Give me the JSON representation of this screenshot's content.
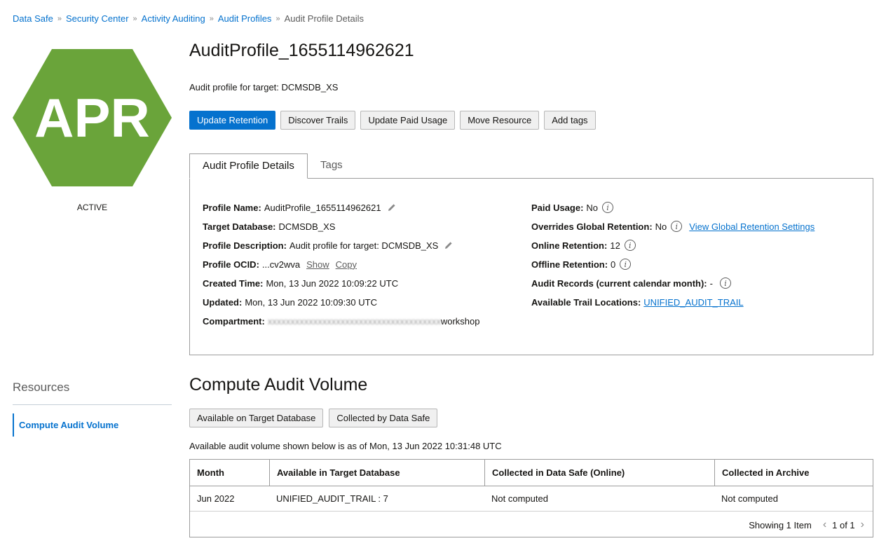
{
  "breadcrumb": {
    "items": [
      "Data Safe",
      "Security Center",
      "Activity Auditing",
      "Audit Profiles"
    ],
    "current": "Audit Profile Details",
    "separator": "»"
  },
  "badge": {
    "initials": "APR",
    "color": "#6aa43a",
    "status": "ACTIVE"
  },
  "header": {
    "title": "AuditProfile_1655114962621",
    "subtitle": "Audit profile for target: DCMSDB_XS"
  },
  "actions": [
    "Update Retention",
    "Discover Trails",
    "Update Paid Usage",
    "Move Resource",
    "Add tags"
  ],
  "tabs": {
    "active": "Audit Profile Details",
    "inactive": "Tags"
  },
  "details": {
    "left": {
      "profile_name": {
        "label": "Profile Name:",
        "value": "AuditProfile_1655114962621"
      },
      "target_database": {
        "label": "Target Database:",
        "value": "DCMSDB_XS"
      },
      "profile_description": {
        "label": "Profile Description:",
        "value": "Audit profile for target: DCMSDB_XS"
      },
      "profile_ocid": {
        "label": "Profile OCID:",
        "value": "...cv2wva",
        "show": "Show",
        "copy": "Copy"
      },
      "created_time": {
        "label": "Created Time:",
        "value": "Mon, 13 Jun 2022 10:09:22 UTC"
      },
      "updated": {
        "label": "Updated:",
        "value": "Mon, 13 Jun 2022 10:09:30 UTC"
      },
      "compartment": {
        "label": "Compartment:",
        "value_redacted": "xxxxxxxxxxxxxxxxxxxxxxxxxxxxxxxxxxxxxx",
        "value_tail": "workshop"
      }
    },
    "right": {
      "paid_usage": {
        "label": "Paid Usage:",
        "value": "No"
      },
      "overrides_global_retention": {
        "label": "Overrides Global Retention:",
        "value": "No",
        "link": "View Global Retention Settings"
      },
      "online_retention": {
        "label": "Online Retention:",
        "value": "12"
      },
      "offline_retention": {
        "label": "Offline Retention:",
        "value": "0"
      },
      "audit_records": {
        "label": "Audit Records (current calendar month):",
        "value": "-"
      },
      "trail_locations": {
        "label": "Available Trail Locations:",
        "value": "UNIFIED_AUDIT_TRAIL"
      }
    }
  },
  "resources": {
    "title": "Resources",
    "items": [
      "Compute Audit Volume"
    ]
  },
  "compute": {
    "title": "Compute Audit Volume",
    "buttons": [
      "Available on Target Database",
      "Collected by Data Safe"
    ],
    "as_of": "Available audit volume shown below is as of Mon, 13 Jun 2022 10:31:48 UTC",
    "columns": [
      "Month",
      "Available in Target Database",
      "Collected in Data Safe (Online)",
      "Collected in Archive"
    ],
    "rows": [
      [
        "Jun 2022",
        "UNIFIED_AUDIT_TRAIL : 7",
        "Not computed",
        "Not computed"
      ]
    ],
    "footer": {
      "showing": "Showing 1 Item",
      "page": "1 of 1"
    }
  },
  "colors": {
    "accent": "#0572ce",
    "badge_green": "#6aa43a",
    "border": "#9c9c9c"
  }
}
